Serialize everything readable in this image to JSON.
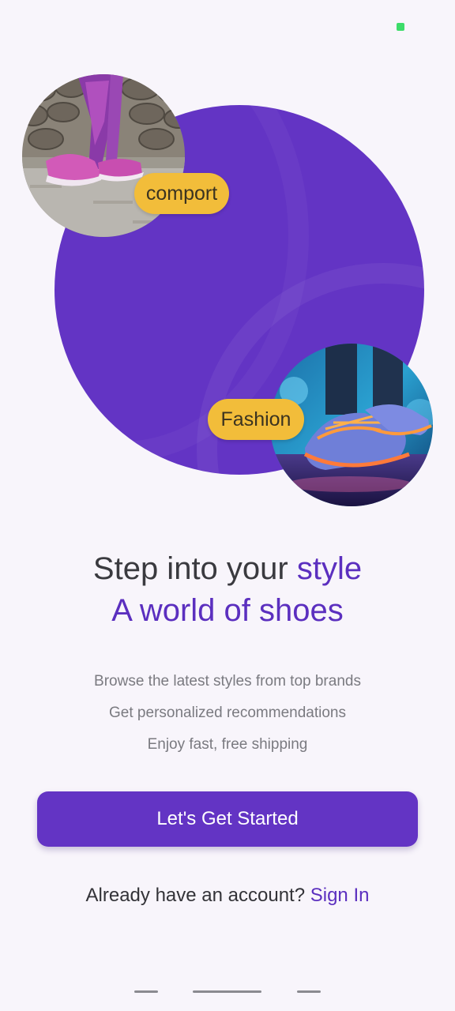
{
  "hero": {
    "tag_top": "comport",
    "tag_bottom": "Fashion"
  },
  "headline": {
    "line1_plain": "Step into your ",
    "line1_accent": "style",
    "line2": "A world of shoes"
  },
  "features": [
    "Browse the latest styles from top brands",
    "Get personalized recommendations",
    "Enjoy fast, free shipping"
  ],
  "cta_label": "Let's Get Started",
  "signin": {
    "prompt": "Already have an account? ",
    "link": "Sign In"
  },
  "colors": {
    "primary": "#6334c4",
    "accent_text": "#5b2fbf",
    "tag": "#f2bd3a",
    "background": "#f8f5fb"
  },
  "icons": [
    "battery-indicator-icon",
    "nav-back-icon",
    "nav-home-icon",
    "nav-recents-icon"
  ]
}
